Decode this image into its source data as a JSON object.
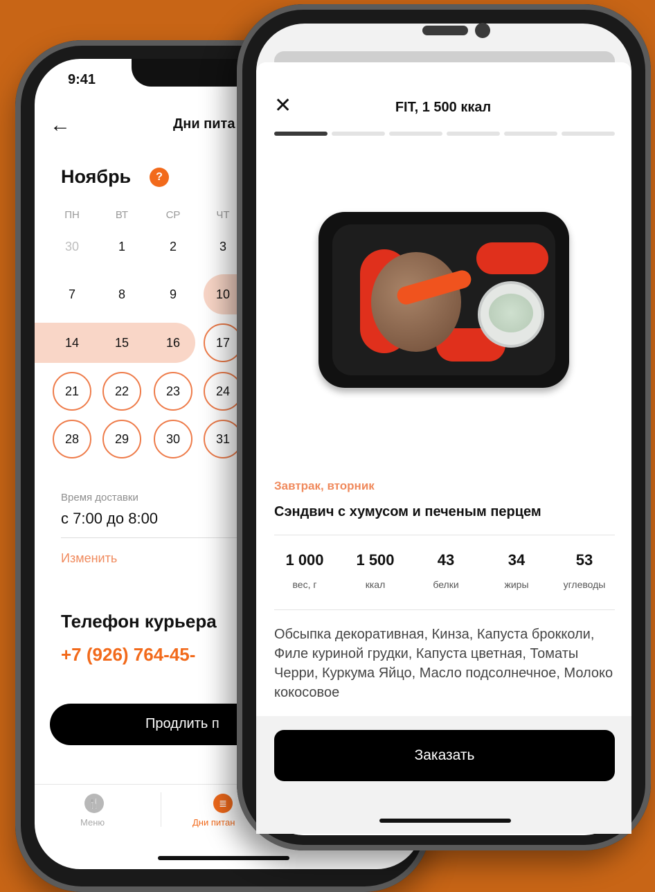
{
  "back_screen": {
    "status_time": "9:41",
    "header_title": "Дни пита",
    "month": "Ноябрь",
    "help_badge": "?",
    "weekdays": [
      "ПН",
      "ВТ",
      "СР",
      "ЧТ"
    ],
    "calendar_rows": [
      [
        "30",
        "1",
        "2",
        "3"
      ],
      [
        "7",
        "8",
        "9",
        "10"
      ],
      [
        "14",
        "15",
        "16",
        "17"
      ],
      [
        "21",
        "22",
        "23",
        "24"
      ],
      [
        "28",
        "29",
        "30",
        "31"
      ]
    ],
    "delivery_label": "Время доставки",
    "delivery_value": "с 7:00 до 8:00",
    "change_link": "Изменить",
    "courier_title": "Телефон курьера",
    "courier_phone": "+7 (926) 764-45-",
    "renew_button": "Продлить п",
    "tabs": [
      {
        "label": "Меню",
        "icon": "fork-knife-icon"
      },
      {
        "label": "Дни питан",
        "icon": "document-icon"
      }
    ],
    "colors": {
      "accent": "#F26A1B",
      "range": "#F9D6C7",
      "ring": "#EE7B49",
      "background": "#C86516"
    }
  },
  "front_screen": {
    "close_icon": "✕",
    "title": "FIT, 1 500 ккал",
    "progress_steps_total": 6,
    "progress_step_current": 1,
    "meal_type": "Завтрак, вторник",
    "meal_name": "Сэндвич с хумусом и печеным перцем",
    "nutrition": [
      {
        "value": "1 000",
        "label": "вес, г"
      },
      {
        "value": "1 500",
        "label": "ккал"
      },
      {
        "value": "43",
        "label": "белки"
      },
      {
        "value": "34",
        "label": "жиры"
      },
      {
        "value": "53",
        "label": "углеводы"
      }
    ],
    "ingredients": "Обсыпка декоративная, Кинза, Капуста брокколи, Филе куриной грудки, Капуста цветная, Томаты Черри, Куркума Яйцо, Масло подсолнечное, Молоко кокосовое",
    "order_button": "Заказать"
  }
}
